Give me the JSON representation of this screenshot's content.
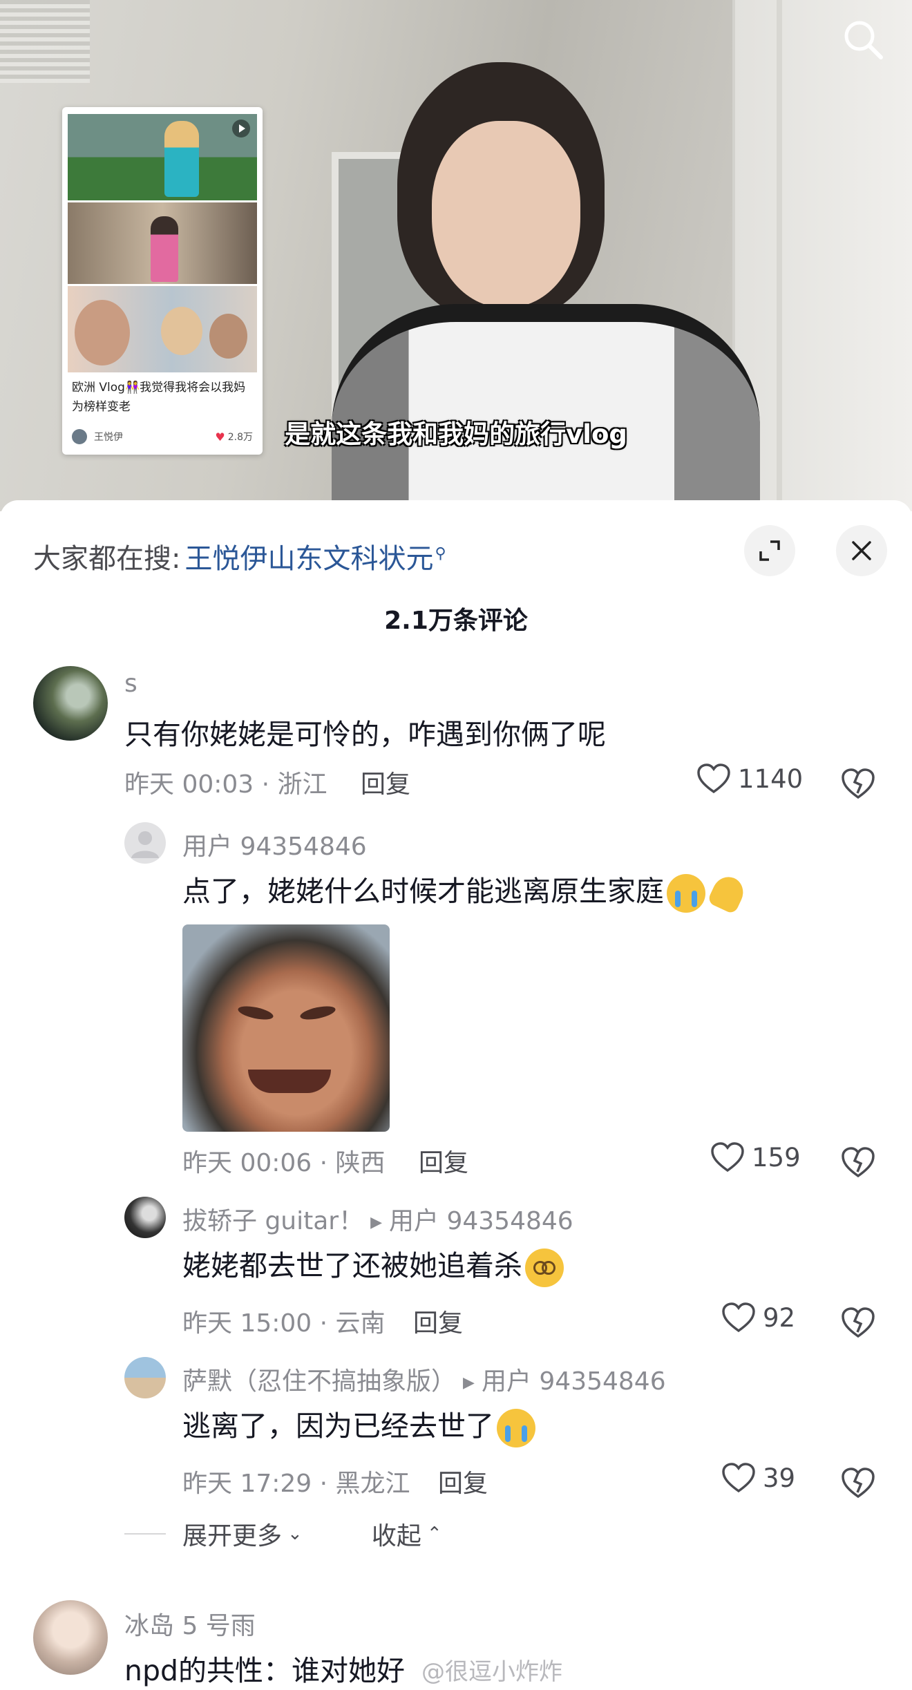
{
  "video": {
    "subtitle": "是就这条我和我妈的旅行vlog",
    "inset_card": {
      "title": "欧洲 Vlog👭我觉得我将会以我妈为榜样变老",
      "author": "王悦伊",
      "likes": "2.8万"
    }
  },
  "sheet": {
    "trending_prefix": "大家都在搜:",
    "trending_query": "王悦伊山东文科状元",
    "comment_count": "2.1万条评论",
    "more_label": "展开更多",
    "collapse_label": "收起"
  },
  "comments": [
    {
      "user": "s",
      "text": "只有你姥姥是可怜的，咋遇到你俩了呢",
      "time": "昨天 00:03 · 浙江",
      "reply": "回复",
      "likes": "1140"
    }
  ],
  "replies": [
    {
      "user": "用户 94354846",
      "text": "点了，姥姥什么时候才能逃离原生家庭",
      "time": "昨天 00:06 · 陕西",
      "reply": "回复",
      "likes": "159"
    },
    {
      "user": "拔轿子 guitar！",
      "reply_to": "用户 94354846",
      "text": "姥姥都去世了还被她追着杀",
      "time": "昨天 15:00 · 云南",
      "reply": "回复",
      "likes": "92"
    },
    {
      "user": "萨默（忍住不搞抽象版）",
      "reply_to": "用户 94354846",
      "text": "逃离了，因为已经去世了",
      "time": "昨天 17:29 · 黑龙江",
      "reply": "回复",
      "likes": "39"
    }
  ],
  "next_comment": {
    "user": "冰岛 5 号雨",
    "text": "npd的共性：谁对她好",
    "watermark": "@很逗小炸炸"
  },
  "colors": {
    "link": "#2b5797",
    "muted": "#8a8b91",
    "like_red": "#e8334d"
  },
  "icons": [
    "search-icon",
    "expand-icon",
    "close-icon",
    "heart-outline-icon",
    "dislike-heart-icon",
    "chevron-down-icon",
    "chevron-up-icon",
    "play-icon"
  ]
}
